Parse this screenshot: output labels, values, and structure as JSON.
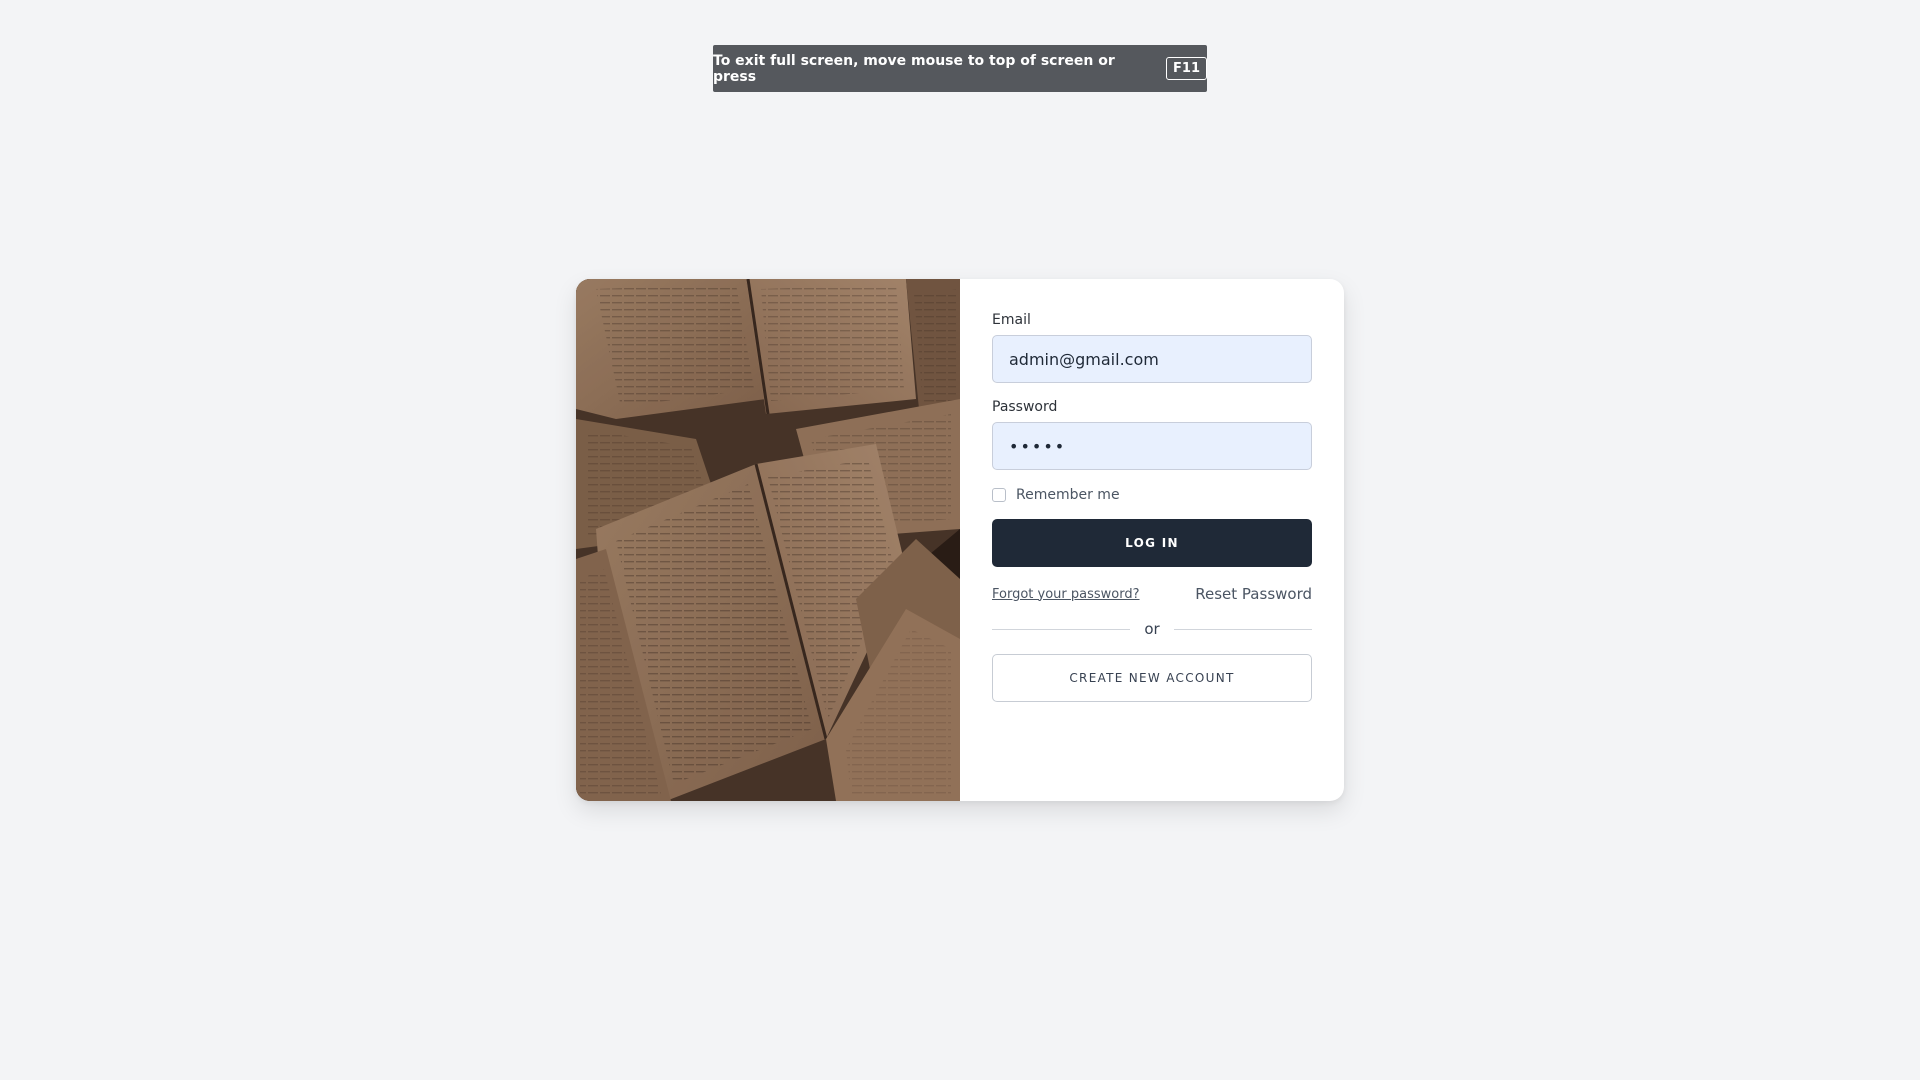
{
  "fullscreen_notice": {
    "message": "To exit full screen, move mouse to top of screen or press",
    "key": "F11"
  },
  "login": {
    "email_label": "Email",
    "email_value": "admin@gmail.com",
    "password_label": "Password",
    "password_value": "•••••",
    "remember_label": "Remember me",
    "remember_checked": false,
    "login_button": "LOG IN",
    "forgot_link": "Forgot your password?",
    "reset_link": "Reset Password",
    "divider_text": "or",
    "create_button": "CREATE NEW ACCOUNT"
  },
  "colors": {
    "page_bg": "#f3f4f6",
    "primary_button": "#1f2937",
    "input_bg": "#e8f0fe",
    "banner_bg": "#55585d"
  }
}
